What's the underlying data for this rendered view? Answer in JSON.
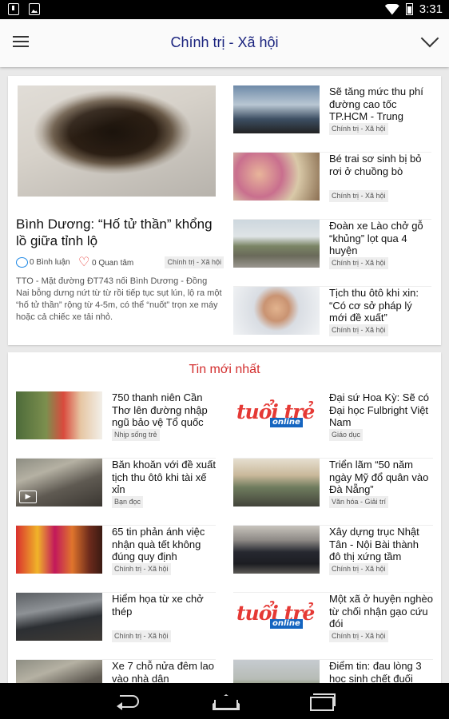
{
  "status_bar": {
    "time": "3:31"
  },
  "app_bar": {
    "title": "Chính trị - Xã hội"
  },
  "featured": {
    "title": "Bình Dương: “Hố tử thần” khổng lồ giữa tỉnh lộ",
    "comments": "0 Bình luận",
    "likes": "0 Quan tâm",
    "category": "Chính trị - Xã hội",
    "summary": "TTO - Mặt đường ĐT743 nối Bình Dương - Đồng Nai bỗng dưng nứt từ từ rồi tiếp tục sụt lún, lộ ra một “hố tử thần” rộng từ 4-5m, có thể “nuốt” trọn xe máy hoặc cả chiếc xe tải nhỏ."
  },
  "side_articles": [
    {
      "title": "Sẽ tăng mức thu phí đường cao tốc TP.HCM - Trung",
      "category": "Chính trị - Xã hội"
    },
    {
      "title": "Bé trai sơ sinh bị bỏ rơi ở chuồng bò",
      "category": "Chính trị - Xã hội"
    },
    {
      "title": "Đoàn xe Lào chở gỗ “khủng” lọt qua 4 huyện",
      "category": "Chính trị - Xã hội"
    },
    {
      "title": "Tịch thu ôtô khi xin: “Có cơ sở pháp lý mới đề xuất”",
      "category": "Chính trị - Xã hội"
    }
  ],
  "latest": {
    "heading": "Tin mới nhất",
    "logo": {
      "main": "tuổi trẻ",
      "sub": "online"
    },
    "video_badge": "▶",
    "items": [
      {
        "title": "750 thanh niên Cần Thơ lên đường nhập ngũ bảo vệ Tổ quốc",
        "category": "Nhịp sống trẻ"
      },
      {
        "title": "Đại sứ Hoa Kỳ: Sẽ có Đại học Fulbright Việt Nam",
        "category": "Giáo dục"
      },
      {
        "title": "Băn khoăn với đề xuất tịch thu ôtô khi tài xế xỉn",
        "category": "Bạn đọc"
      },
      {
        "title": "Triển lãm “50 năm ngày Mỹ đổ quân vào Đà Nẵng”",
        "category": "Văn hóa - Giải trí"
      },
      {
        "title": "65 tin phản ánh việc nhận quà tết không đúng quy định",
        "category": "Chính trị - Xã hội"
      },
      {
        "title": "Xây dựng trục Nhật Tân - Nội Bài thành đô thị xứng tầm",
        "category": "Chính trị - Xã hội"
      },
      {
        "title": "Hiểm họa từ xe chở thép",
        "category": "Chính trị - Xã hội"
      },
      {
        "title": "Một xã ở huyện nghèo từ chối nhận gạo cứu đói",
        "category": "Chính trị - Xã hội"
      },
      {
        "title": "Xe 7 chỗ nửa đêm lao vào nhà dân",
        "category": ""
      },
      {
        "title": "Điểm tin: đau lòng 3 học sinh chết đuối",
        "category": ""
      }
    ]
  }
}
